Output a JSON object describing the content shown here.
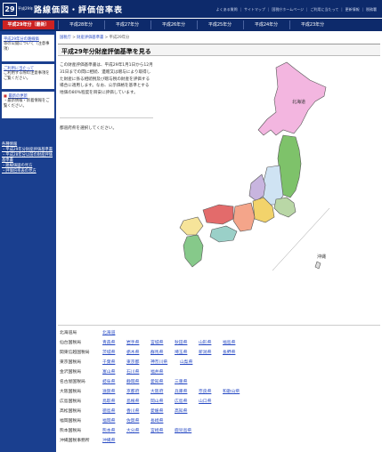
{
  "header": {
    "logo": "29",
    "brand_small": "平成29年",
    "title": "路線価図・評価倍率表",
    "nav": [
      "よくある質問",
      "サイトマップ",
      "国税庁ホームページ",
      "ご利用に当たって",
      "更新情報",
      "税務署"
    ]
  },
  "year_tabs": [
    "平成29年分（最新）",
    "平成28年分",
    "平成27年分",
    "平成26年分",
    "平成25年分",
    "平成24年分",
    "平成23年分"
  ],
  "sidebar": {
    "box1_title": "平成29年分の路線価",
    "box1_text": "等の公開について（注意事項）",
    "box2_title": "ご利用に当たって",
    "box2_text": "ご利用する際の注意事項をご覧ください。",
    "box3_title": "最新の更新",
    "box3_text": "・最新情報・新着情報をご覧ください。",
    "info_title": "各種情報",
    "info_lines": [
      "・平成29年分財産評価基準書",
      "・平成28年分以前の財産評価基準書",
      "・路線価図の見方",
      "・評価倍率表の見方"
    ]
  },
  "breadcrumb": {
    "items": [
      "国税庁",
      "財産評価基準書",
      "平成29年分"
    ],
    "sep": " > "
  },
  "section_title": "平成29年分財産評価基準を見る",
  "description": "この財産評価基準書は、平成29年1月1日から12月31日までの間に相続、遺贈又は贈与により取得した財産に係る相続税及び贈与税の財産を評価する場合に適用します。なお、公示価格を基準とする地価の80%程度を目安に評価しています。",
  "note": "都道府県を選択してください。",
  "map_labels": {
    "hokkaido": "北海道",
    "okinawa": "沖縄"
  },
  "regions": [
    {
      "name": "北海道局",
      "prefs": [
        "北海道"
      ]
    },
    {
      "name": "仙台国税局",
      "prefs": [
        "青森県",
        "岩手県",
        "宮城県",
        "秋田県",
        "山形県",
        "福島県"
      ]
    },
    {
      "name": "関東信越国税局",
      "prefs": [
        "茨城県",
        "栃木県",
        "群馬県",
        "埼玉県",
        "新潟県",
        "長野県"
      ]
    },
    {
      "name": "東京国税局",
      "prefs": [
        "千葉県",
        "東京都",
        "神奈川県",
        "山梨県"
      ]
    },
    {
      "name": "金沢国税局",
      "prefs": [
        "富山県",
        "石川県",
        "福井県"
      ]
    },
    {
      "name": "名古屋国税局",
      "prefs": [
        "岐阜県",
        "静岡県",
        "愛知県",
        "三重県"
      ]
    },
    {
      "name": "大阪国税局",
      "prefs": [
        "滋賀県",
        "京都府",
        "大阪府",
        "兵庫県",
        "奈良県",
        "和歌山県"
      ]
    },
    {
      "name": "広島国税局",
      "prefs": [
        "鳥取県",
        "島根県",
        "岡山県",
        "広島県",
        "山口県"
      ]
    },
    {
      "name": "高松国税局",
      "prefs": [
        "徳島県",
        "香川県",
        "愛媛県",
        "高知県"
      ]
    },
    {
      "name": "福岡国税局",
      "prefs": [
        "福岡県",
        "佐賀県",
        "長崎県"
      ]
    },
    {
      "name": "熊本国税局",
      "prefs": [
        "熊本県",
        "大分県",
        "宮崎県",
        "鹿児島県"
      ]
    },
    {
      "name": "沖縄国税事務所",
      "prefs": [
        "沖縄県"
      ]
    }
  ]
}
